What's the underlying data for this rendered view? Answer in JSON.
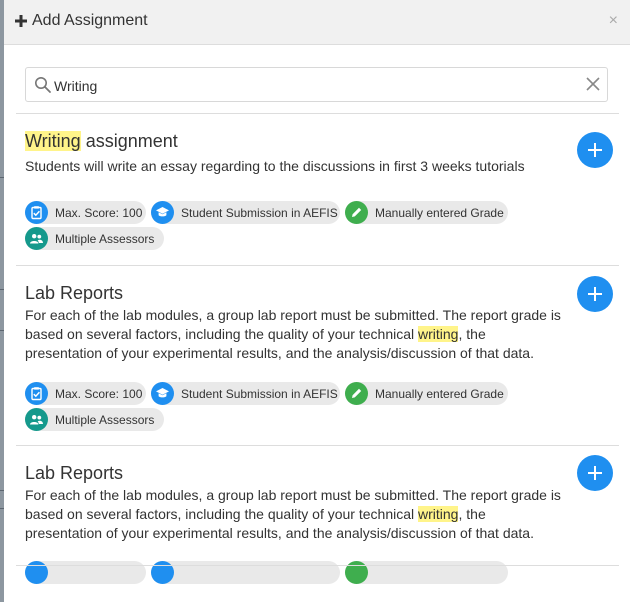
{
  "header": {
    "title": "Add Assignment",
    "close_symbol": "×"
  },
  "search": {
    "value": "Writing"
  },
  "assignments": [
    {
      "title_highlight": "Writing",
      "title_rest": " assignment",
      "description": [
        {
          "text": "Students will write an essay regarding to the discussions in first 3 weeks tutorials",
          "highlight": false
        }
      ]
    },
    {
      "title": "Lab Reports",
      "description": [
        {
          "text": "For each of the lab modules, a group lab report must be submitted. The report grade is based on several factors, including the quality of your technical ",
          "highlight": false
        },
        {
          "text": "writing",
          "highlight": true
        },
        {
          "text": ", the presentation of your experimental results, and the analysis/discussion of that data.",
          "highlight": false
        }
      ]
    },
    {
      "title": "Lab Reports",
      "description": [
        {
          "text": "For each of the lab modules, a group lab report must be submitted. The report grade is based on several factors, including the quality of your technical ",
          "highlight": false
        },
        {
          "text": "writing",
          "highlight": true
        },
        {
          "text": ", the presentation of your experimental results, and the analysis/discussion of that data.",
          "highlight": false
        }
      ]
    }
  ],
  "chips": {
    "max_score": "Max. Score: 100",
    "submission": "Student Submission in AEFIS",
    "grade": "Manually entered Grade",
    "assessors": "Multiple Assessors"
  },
  "colors": {
    "accent": "#1f8ff0",
    "green": "#3fae4e",
    "teal": "#15998c",
    "highlight": "#fff48a"
  }
}
